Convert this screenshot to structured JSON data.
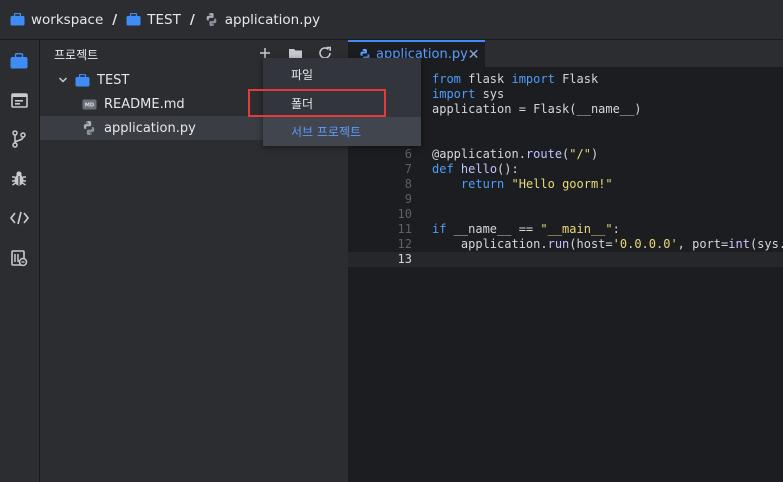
{
  "breadcrumb": {
    "items": [
      "workspace",
      "TEST",
      "application.py"
    ],
    "separator": "/"
  },
  "sidebar": {
    "title": "프로젝트",
    "tree": [
      {
        "label": "TEST",
        "kind": "folder",
        "expanded": true
      },
      {
        "label": "README.md",
        "kind": "markdown",
        "badge": "MD"
      },
      {
        "label": "application.py",
        "kind": "python",
        "selected": true
      }
    ]
  },
  "dropdown": {
    "items": [
      "파일",
      "폴더",
      "서브 프로젝트"
    ],
    "hovered": "서브 프로젝트",
    "highlighted": "폴더"
  },
  "editor": {
    "tab": {
      "label": "application.py"
    },
    "lines": [
      {
        "n": "",
        "code": "from flask import Flask"
      },
      {
        "n": "",
        "code": "import sys"
      },
      {
        "n": "",
        "code": "application = Flask(__name__)"
      },
      {
        "n": "",
        "code": ""
      },
      {
        "n": "",
        "code": ""
      },
      {
        "n": "6",
        "code": "@application.route(\"/\")"
      },
      {
        "n": "7",
        "code": "def hello():"
      },
      {
        "n": "8",
        "code": "    return \"Hello goorm!\""
      },
      {
        "n": "9",
        "code": ""
      },
      {
        "n": "10",
        "code": ""
      },
      {
        "n": "11",
        "code": "if __name__ == \"__main__\":"
      },
      {
        "n": "12",
        "code": "    application.run(host='0.0.0.0', port=int(sys."
      },
      {
        "n": "13",
        "code": "",
        "current": true
      }
    ]
  },
  "colors": {
    "accent": "#3f8cf6",
    "highlight": "#e23b3b",
    "folder": "#3f8cf6"
  }
}
